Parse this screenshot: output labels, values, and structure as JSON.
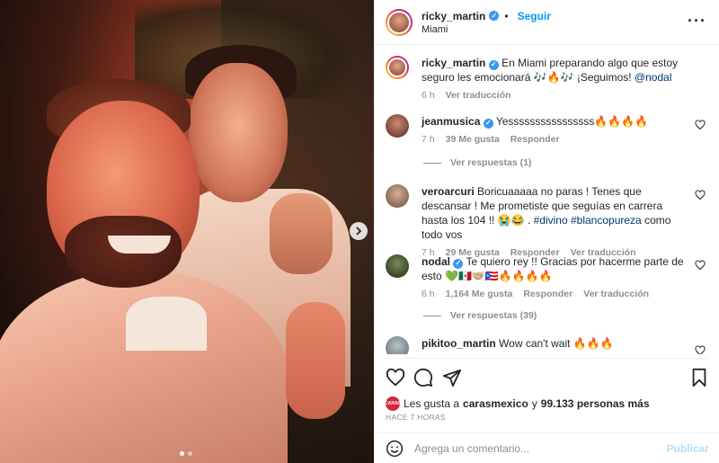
{
  "post": {
    "author": "ricky_martin",
    "follow_label": "Seguir",
    "location": "Miami",
    "more_icon": "more-horizontal-icon",
    "carousel": {
      "total_slides": 2,
      "active_slide": 1,
      "next_icon": "chevron-right-icon"
    }
  },
  "caption": {
    "user": "ricky_martin",
    "text": "En Miami preparando algo que estoy seguro les emocionará 🎶🔥🎶 ¡Seguimos!",
    "mention": "@nodal",
    "time": "6 h",
    "translate": "Ver traducción"
  },
  "comments": [
    {
      "user": "jeanmusica",
      "verified": true,
      "text": "Yessssssssssssssss🔥🔥🔥🔥",
      "time": "7 h",
      "likes": "39 Me gusta",
      "reply": "Responder",
      "replies": "Ver respuestas (1)"
    },
    {
      "user": "veroarcuri",
      "verified": false,
      "text": "Boricuaaaaa no paras ! Tenes que descansar ! Me prometiste que seguías en carrera hasta los 104 !! 😭😂 .",
      "tags": "#divino #blancopureza",
      "text_end": "como todo vos",
      "time": "7 h",
      "likes": "29 Me gusta",
      "reply": "Responder",
      "translate": "Ver traducción"
    },
    {
      "user": "nodal",
      "verified": true,
      "text": "Te quiero rey !! Gracias por hacerme parte de esto 💚🇲🇽🤝🏼🇵🇷🔥🔥🔥🔥",
      "time": "6 h",
      "likes": "1,164 Me gusta",
      "reply": "Responder",
      "translate": "Ver traducción",
      "replies": "Ver respuestas (39)"
    },
    {
      "user": "pikitoo_martin",
      "verified": false,
      "text": "Wow can't wait 🔥🔥🔥"
    }
  ],
  "actions": {
    "like_icon": "heart-icon",
    "comment_icon": "comment-icon",
    "share_icon": "paper-plane-icon",
    "save_icon": "bookmark-icon"
  },
  "likes": {
    "badge_text": "CARAS",
    "prefix": "Les gusta a",
    "user": "carasmexico",
    "middle": "y",
    "count": "99.133 personas más"
  },
  "time_ago": "HACE 7 HORAS",
  "add_comment": {
    "placeholder": "Agrega un comentario...",
    "publish": "Publicar"
  },
  "colors": {
    "follow_blue": "#0095f6",
    "verified_blue": "#3897f0",
    "muted": "#8e8e8e",
    "mention": "#00376b"
  }
}
